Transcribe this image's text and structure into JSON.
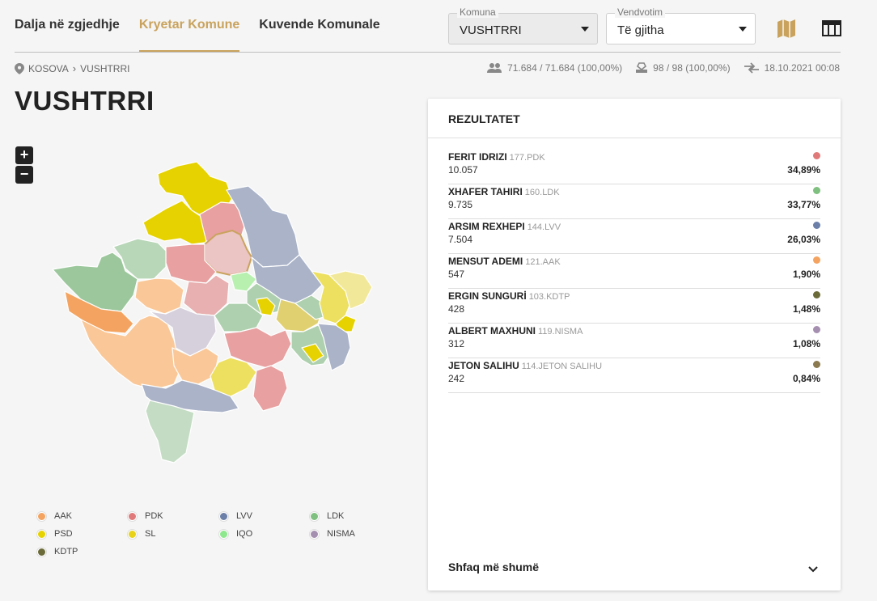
{
  "tabs": [
    {
      "label": "Dalja në zgjedhje",
      "active": false
    },
    {
      "label": "Kryetar Komune",
      "active": true
    },
    {
      "label": "Kuvende Komunale",
      "active": false
    }
  ],
  "filters": {
    "komuna": {
      "label": "Komuna",
      "value": "VUSHTRRI"
    },
    "vendvotim": {
      "label": "Vendvotim",
      "value": "Të gjitha"
    }
  },
  "icons": {
    "map_view": "map-icon",
    "table_view": "table-icon",
    "accent": "#c9a35d"
  },
  "breadcrumb": {
    "root": "KOSOVA",
    "current": "VUSHTRRI"
  },
  "stats": {
    "voters": "71.684 / 71.684 (100,00%)",
    "stations": "98 / 98 (100,00%)",
    "updated": "18.10.2021 00:08"
  },
  "page_title": "VUSHTRRI",
  "zoom": {
    "in": "+",
    "out": "−"
  },
  "legend": [
    {
      "party": "AAK",
      "color": "#f4a460"
    },
    {
      "party": "PDK",
      "color": "#e07a7a"
    },
    {
      "party": "LVV",
      "color": "#6b7fa8"
    },
    {
      "party": "LDK",
      "color": "#7fbf7f"
    },
    {
      "party": "PSD",
      "color": "#e6d200"
    },
    {
      "party": "SL",
      "color": "#e8d21a"
    },
    {
      "party": "IQO",
      "color": "#8ee88e"
    },
    {
      "party": "NISMA",
      "color": "#a58fb0"
    },
    {
      "party": "KDTP",
      "color": "#6b6b3a"
    }
  ],
  "results": {
    "title": "REZULTATET",
    "candidates": [
      {
        "name": "FERIT IDRIZI",
        "code": "177.PDK",
        "votes": "10.057",
        "pct": "34,89%",
        "color": "#e07a7a"
      },
      {
        "name": "XHAFER TAHIRI",
        "code": "160.LDK",
        "votes": "9.735",
        "pct": "33,77%",
        "color": "#7fbf7f"
      },
      {
        "name": "ARSIM REXHEPI",
        "code": "144.LVV",
        "votes": "7.504",
        "pct": "26,03%",
        "color": "#6b7fa8"
      },
      {
        "name": "MENSUT ADEMI",
        "code": "121.AAK",
        "votes": "547",
        "pct": "1,90%",
        "color": "#f4a460"
      },
      {
        "name": "ERGIN SUNGURİ",
        "code": "103.KDTP",
        "votes": "428",
        "pct": "1,48%",
        "color": "#6b6b3a"
      },
      {
        "name": "ALBERT MAXHUNI",
        "code": "119.NISMA",
        "votes": "312",
        "pct": "1,08%",
        "color": "#a58fb0"
      },
      {
        "name": "JETON SALIHU",
        "code": "114.JETON SALIHU",
        "votes": "242",
        "pct": "0,84%",
        "color": "#8b7a50"
      }
    ],
    "show_more": "Shfaq më shumë"
  }
}
